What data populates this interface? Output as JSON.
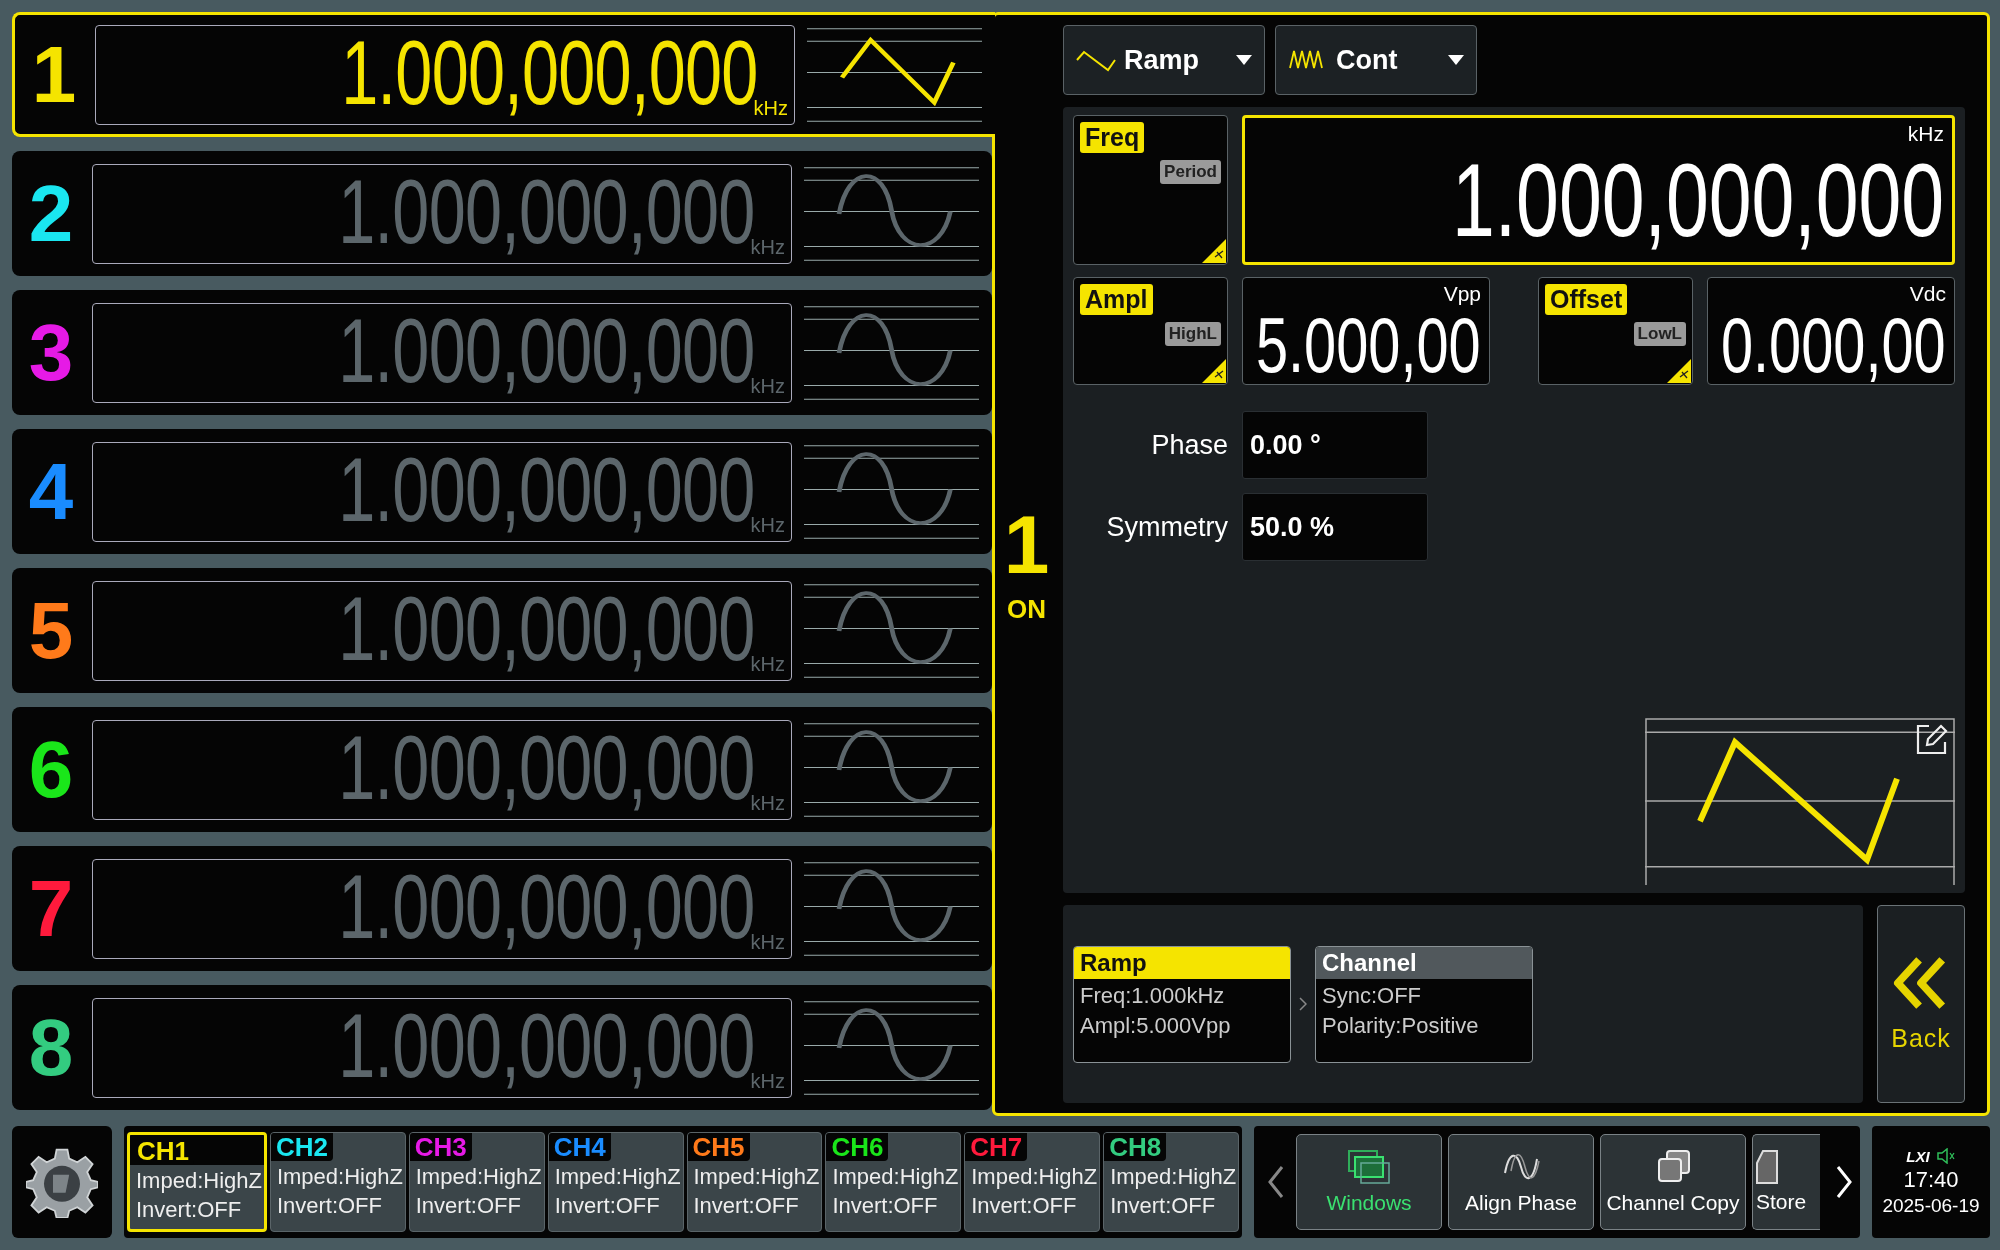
{
  "channels": [
    {
      "number": "1",
      "color": "#f5e400",
      "frequency": "1.000,000,000",
      "unit": "kHz",
      "kind": "ramp",
      "selected": true
    },
    {
      "number": "2",
      "color": "#1ae6f0",
      "frequency": "1.000,000,000",
      "unit": "kHz",
      "kind": "sine",
      "selected": false
    },
    {
      "number": "3",
      "color": "#e61ae6",
      "frequency": "1.000,000,000",
      "unit": "kHz",
      "kind": "sine",
      "selected": false
    },
    {
      "number": "4",
      "color": "#1a8cff",
      "frequency": "1.000,000,000",
      "unit": "kHz",
      "kind": "sine",
      "selected": false
    },
    {
      "number": "5",
      "color": "#ff7a1a",
      "frequency": "1.000,000,000",
      "unit": "kHz",
      "kind": "sine",
      "selected": false
    },
    {
      "number": "6",
      "color": "#1ae61a",
      "frequency": "1.000,000,000",
      "unit": "kHz",
      "kind": "sine",
      "selected": false
    },
    {
      "number": "7",
      "color": "#ff1a3c",
      "frequency": "1.000,000,000",
      "unit": "kHz",
      "kind": "sine",
      "selected": false
    },
    {
      "number": "8",
      "color": "#33cc80",
      "frequency": "1.000,000,000",
      "unit": "kHz",
      "kind": "sine",
      "selected": false
    }
  ],
  "active_channel": {
    "number": "1",
    "state": "ON"
  },
  "dropdowns": [
    {
      "kind": "ramp",
      "label": "Ramp"
    },
    {
      "kind": "burst",
      "label": "Cont"
    }
  ],
  "params": [
    {
      "label": "Freq",
      "alt": "Period",
      "unit": "kHz",
      "value": "1.000,000,000",
      "selected": true
    },
    {
      "label": "Ampl",
      "alt": "HighL",
      "unit": "Vpp",
      "value": "5.000,00",
      "selected": false
    },
    {
      "label": "Offset",
      "alt": "LowL",
      "unit": "Vdc",
      "value": "0.000,00",
      "selected": false
    }
  ],
  "fields": [
    {
      "label": "Phase",
      "value": "0.00 °"
    },
    {
      "label": "Symmetry",
      "value": "50.0 %"
    }
  ],
  "summary": [
    {
      "title": "Ramp",
      "lines": [
        "Freq:1.000kHz",
        "Ampl:5.000Vpp"
      ],
      "selected": true
    },
    {
      "title": "Channel",
      "lines": [
        "Sync:OFF",
        "Polarity:Positive"
      ],
      "selected": false
    }
  ],
  "back_button": "Back",
  "channel_tabs": [
    {
      "label": "CH1",
      "color": "#f5e400",
      "imped": "Imped:HighZ",
      "invert": "Invert:OFF",
      "selected": true
    },
    {
      "label": "CH2",
      "color": "#1ae6f0",
      "imped": "Imped:HighZ",
      "invert": "Invert:OFF",
      "selected": false
    },
    {
      "label": "CH3",
      "color": "#e61ae6",
      "imped": "Imped:HighZ",
      "invert": "Invert:OFF",
      "selected": false
    },
    {
      "label": "CH4",
      "color": "#1a8cff",
      "imped": "Imped:HighZ",
      "invert": "Invert:OFF",
      "selected": false
    },
    {
      "label": "CH5",
      "color": "#ff7a1a",
      "imped": "Imped:HighZ",
      "invert": "Invert:OFF",
      "selected": false
    },
    {
      "label": "CH6",
      "color": "#1ae61a",
      "imped": "Imped:HighZ",
      "invert": "Invert:OFF",
      "selected": false
    },
    {
      "label": "CH7",
      "color": "#ff1a3c",
      "imped": "Imped:HighZ",
      "invert": "Invert:OFF",
      "selected": false
    },
    {
      "label": "CH8",
      "color": "#33cc80",
      "imped": "Imped:HighZ",
      "invert": "Invert:OFF",
      "selected": false
    }
  ],
  "softkeys": [
    {
      "kind": "windows",
      "label": "Windows",
      "selected": true
    },
    {
      "kind": "align",
      "label": "Align Phase",
      "selected": false
    },
    {
      "kind": "copy",
      "label": "Channel Copy",
      "selected": false
    },
    {
      "kind": "store",
      "label": "Store",
      "selected": false
    }
  ],
  "status": {
    "brand": "LXI",
    "time": "17:40",
    "date": "2025-06-19"
  }
}
